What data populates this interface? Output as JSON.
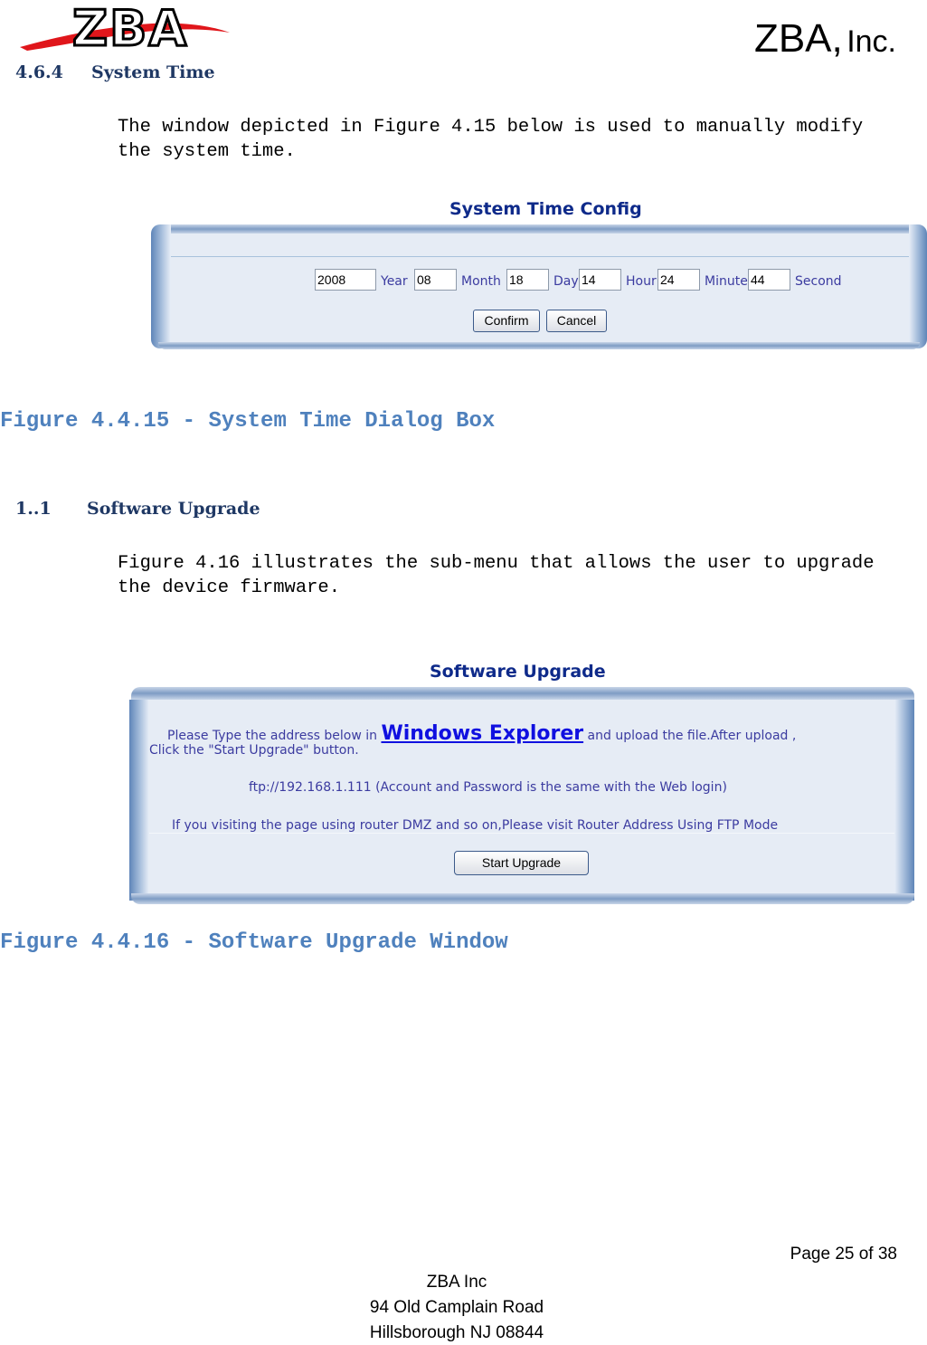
{
  "header": {
    "logo_text": "ZBA",
    "company_name": "ZBA,",
    "company_suffix": "Inc."
  },
  "section1": {
    "number": "4.6.4",
    "title": "System Time",
    "body_line1": "The window depicted in Figure 4.15 below is used to manually modify",
    "body_line2": "the system time."
  },
  "system_time_dialog": {
    "title": "System Time Config",
    "fields": [
      {
        "value": "2008",
        "label": "Year"
      },
      {
        "value": "08",
        "label": "Month"
      },
      {
        "value": "18",
        "label": "Day"
      },
      {
        "value": "14",
        "label": "Hour"
      },
      {
        "value": "24",
        "label": "Minute"
      },
      {
        "value": "44",
        "label": "Second"
      }
    ],
    "confirm_label": "Confirm",
    "cancel_label": "Cancel"
  },
  "caption1": "Figure 4.4.15 - System Time Dialog Box",
  "section2": {
    "number": "1..1",
    "title": "Software Upgrade",
    "body_line1": "Figure 4.16 illustrates the sub-menu that allows the user to upgrade",
    "body_line2": "the device firmware."
  },
  "software_upgrade_dialog": {
    "title": "Software Upgrade",
    "text_before_link": "Please Type the address below in",
    "link_label": "Windows Explorer",
    "text_after_link": "and upload the file.After upload ,",
    "line2": "Click the \"Start Upgrade\" button.",
    "ftp_line": "ftp://192.168.1.111 (Account and Password is the same with the Web login)",
    "dmz_line": "If you visiting the page using router DMZ and so on,Please visit Router Address Using FTP Mode",
    "start_upgrade_label": "Start Upgrade"
  },
  "caption2": "Figure 4.4.16 - Software Upgrade Window",
  "footer": {
    "page": "Page 25 of 38",
    "line1": "ZBA Inc",
    "line2": "94 Old Camplain Road",
    "line3": "Hillsborough NJ 08844"
  }
}
